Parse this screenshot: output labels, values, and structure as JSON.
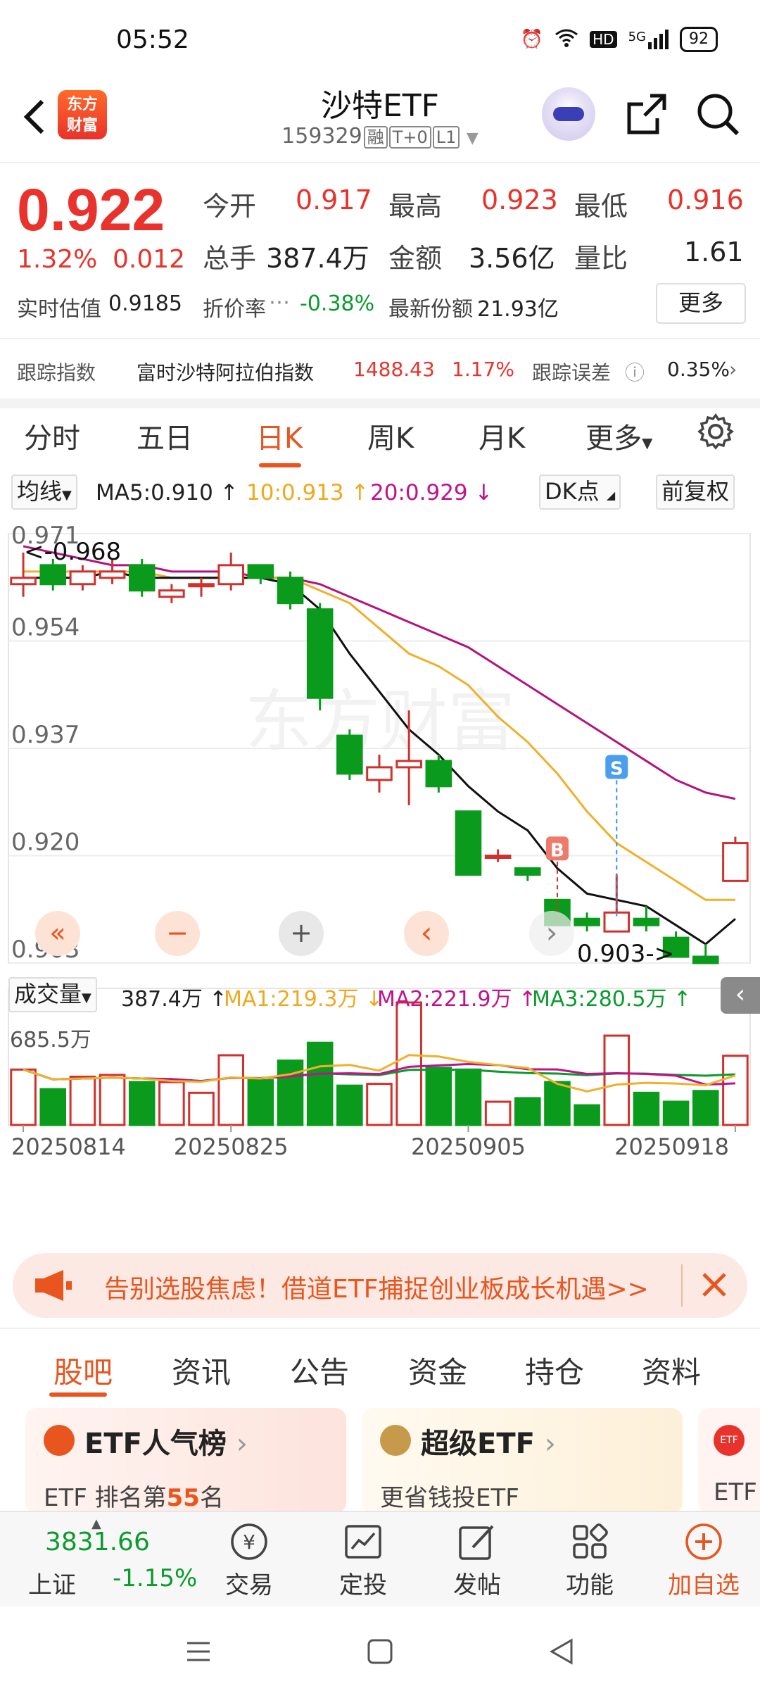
{
  "status_bar": {
    "time": "05:52",
    "hd": "HD",
    "net": "5G",
    "battery": "92"
  },
  "header": {
    "logo_line1": "东方",
    "logo_line2": "财富",
    "title": "沙特ETF",
    "code": "159329",
    "tags": [
      "融",
      "T+0",
      "L1"
    ]
  },
  "quote": {
    "price": "0.922",
    "change_pct": "1.32%",
    "change": "0.012",
    "open_label": "今开",
    "open": "0.917",
    "high_label": "最高",
    "high": "0.923",
    "low_label": "最低",
    "low": "0.916",
    "volume_label": "总手",
    "volume": "387.4万",
    "amount_label": "金额",
    "amount": "3.56亿",
    "ratio_label": "量比",
    "ratio": "1.61",
    "iopv_label": "实时估值",
    "iopv": "0.9185",
    "discount_label": "折价率",
    "discount": "-0.38%",
    "shares_label": "最新份额",
    "shares": "21.93亿",
    "more": "更多"
  },
  "tracking": {
    "label": "跟踪指数",
    "index_name": "富时沙特阿拉伯指数",
    "index_value": "1488.43",
    "index_change": "1.17%",
    "error_label": "跟踪误差",
    "error_value": "0.35%"
  },
  "kline_tabs": [
    "分时",
    "五日",
    "日K",
    "周K",
    "月K",
    "更多"
  ],
  "ma_bar": {
    "selector": "均线",
    "ma5": "MA5:0.910",
    "ma10": "10:0.913",
    "ma20": "20:0.929",
    "dk": "DK点",
    "adjust": "前复权"
  },
  "volume_bar": {
    "selector": "成交量",
    "vol": "387.4万",
    "ma1": "MA1:219.3万",
    "ma2": "MA2:221.9万",
    "ma3": "MA3:280.5万",
    "max_label": "685.5万"
  },
  "chart_data": {
    "type": "candlestick",
    "y_ticks": [
      "0.971",
      "0.954",
      "0.937",
      "0.920",
      "0.903"
    ],
    "ylim": [
      0.903,
      0.971
    ],
    "x_ticks": [
      "20250814",
      "20250825",
      "20250905",
      "20250918"
    ],
    "high_label": "<-0.968",
    "low_label": "0.903->",
    "markers": [
      {
        "text": "B",
        "index": 18
      },
      {
        "text": "S",
        "index": 20
      }
    ],
    "candles": [
      {
        "o": 0.963,
        "c": 0.964,
        "h": 0.968,
        "l": 0.961,
        "v": 310
      },
      {
        "o": 0.966,
        "c": 0.963,
        "h": 0.967,
        "l": 0.962,
        "v": 200
      },
      {
        "o": 0.963,
        "c": 0.965,
        "h": 0.966,
        "l": 0.962,
        "v": 270
      },
      {
        "o": 0.964,
        "c": 0.965,
        "h": 0.967,
        "l": 0.963,
        "v": 280
      },
      {
        "o": 0.966,
        "c": 0.962,
        "h": 0.967,
        "l": 0.961,
        "v": 240
      },
      {
        "o": 0.961,
        "c": 0.962,
        "h": 0.963,
        "l": 0.96,
        "v": 240
      },
      {
        "o": 0.963,
        "c": 0.963,
        "h": 0.964,
        "l": 0.961,
        "v": 180
      },
      {
        "o": 0.963,
        "c": 0.966,
        "h": 0.968,
        "l": 0.962,
        "v": 390
      },
      {
        "o": 0.966,
        "c": 0.964,
        "h": 0.966,
        "l": 0.963,
        "v": 250
      },
      {
        "o": 0.964,
        "c": 0.96,
        "h": 0.965,
        "l": 0.959,
        "v": 360
      },
      {
        "o": 0.959,
        "c": 0.945,
        "h": 0.96,
        "l": 0.943,
        "v": 460
      },
      {
        "o": 0.939,
        "c": 0.933,
        "h": 0.94,
        "l": 0.932,
        "v": 220
      },
      {
        "o": 0.932,
        "c": 0.934,
        "h": 0.936,
        "l": 0.93,
        "v": 230
      },
      {
        "o": 0.934,
        "c": 0.935,
        "h": 0.943,
        "l": 0.928,
        "v": 685.5
      },
      {
        "o": 0.935,
        "c": 0.931,
        "h": 0.936,
        "l": 0.93,
        "v": 320
      },
      {
        "o": 0.927,
        "c": 0.917,
        "h": 0.927,
        "l": 0.917,
        "v": 310
      },
      {
        "o": 0.92,
        "c": 0.92,
        "h": 0.921,
        "l": 0.919,
        "v": 130
      },
      {
        "o": 0.918,
        "c": 0.917,
        "h": 0.918,
        "l": 0.916,
        "v": 150
      },
      {
        "o": 0.913,
        "c": 0.909,
        "h": 0.913,
        "l": 0.909,
        "v": 240
      },
      {
        "o": 0.91,
        "c": 0.909,
        "h": 0.911,
        "l": 0.908,
        "v": 110
      },
      {
        "o": 0.908,
        "c": 0.911,
        "h": 0.917,
        "l": 0.908,
        "v": 500
      },
      {
        "o": 0.91,
        "c": 0.909,
        "h": 0.912,
        "l": 0.908,
        "v": 180
      },
      {
        "o": 0.907,
        "c": 0.904,
        "h": 0.908,
        "l": 0.904,
        "v": 130
      },
      {
        "o": 0.904,
        "c": 0.903,
        "h": 0.906,
        "l": 0.903,
        "v": 190
      },
      {
        "o": 0.916,
        "c": 0.922,
        "h": 0.923,
        "l": 0.916,
        "v": 387.4
      }
    ],
    "ma5": [
      0.964,
      0.964,
      0.964,
      0.965,
      0.964,
      0.964,
      0.964,
      0.964,
      0.964,
      0.963,
      0.959,
      0.952,
      0.946,
      0.94,
      0.936,
      0.931,
      0.927,
      0.924,
      0.918,
      0.914,
      0.913,
      0.912,
      0.909,
      0.906,
      0.91
    ],
    "ma10": [
      0.965,
      0.965,
      0.965,
      0.965,
      0.965,
      0.964,
      0.964,
      0.964,
      0.964,
      0.964,
      0.962,
      0.96,
      0.956,
      0.952,
      0.95,
      0.947,
      0.942,
      0.938,
      0.933,
      0.927,
      0.922,
      0.919,
      0.916,
      0.913,
      0.913
    ],
    "ma20": [
      0.969,
      0.968,
      0.967,
      0.966,
      0.966,
      0.965,
      0.965,
      0.965,
      0.964,
      0.964,
      0.963,
      0.961,
      0.959,
      0.957,
      0.955,
      0.953,
      0.95,
      0.947,
      0.944,
      0.941,
      0.938,
      0.935,
      0.932,
      0.93,
      0.929
    ]
  },
  "chart_controls": [
    "«",
    "−",
    "+",
    "‹",
    "›"
  ],
  "banner": {
    "text": "告别选股焦虑！借道ETF捕捉创业板成长机遇>>"
  },
  "bottom_tabs": [
    "股吧",
    "资讯",
    "公告",
    "资金",
    "持仓",
    "资料"
  ],
  "cards": [
    {
      "title": "ETF人气榜",
      "sub_prefix": "ETF 排名第",
      "sub_num": "55",
      "sub_suffix": "名"
    },
    {
      "title": "超级ETF",
      "sub": "更省钱投ETF"
    },
    {
      "title": "ETF",
      "sub": "ETF"
    }
  ],
  "toolbar": {
    "index_value": "3831.66",
    "index_name": "上证",
    "index_change": "-1.15%",
    "items": [
      "交易",
      "定投",
      "发帖",
      "功能",
      "加自选"
    ]
  }
}
